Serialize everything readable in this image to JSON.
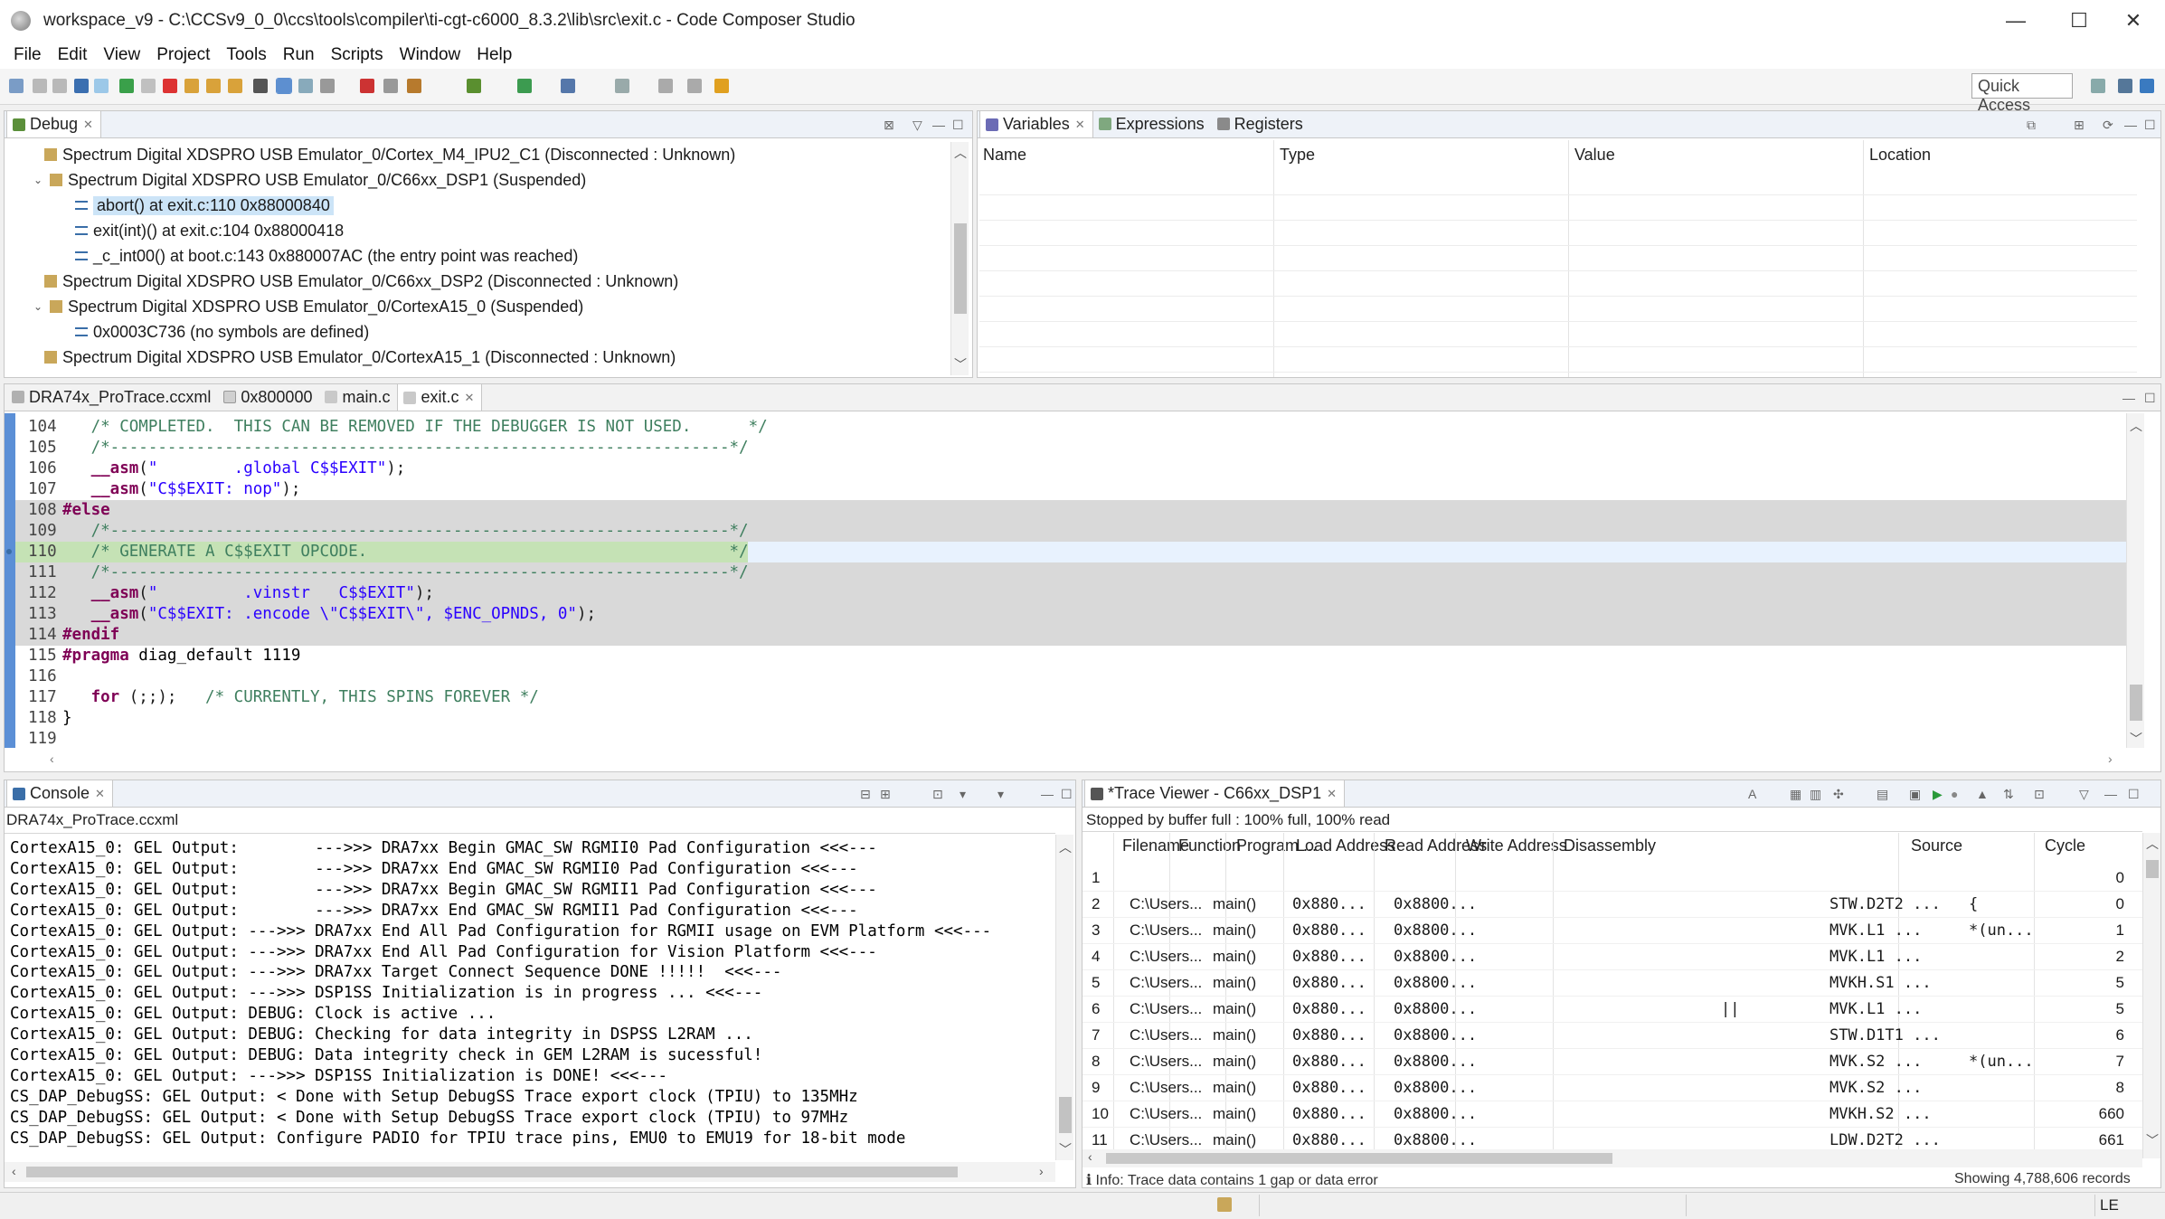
{
  "window": {
    "title": "workspace_v9 - C:\\CCSv9_0_0\\ccs\\tools\\compiler\\ti-cgt-c6000_8.3.2\\lib\\src\\exit.c - Code Composer Studio",
    "minimize": "—",
    "maximize": "☐",
    "close": "✕"
  },
  "menu": [
    "File",
    "Edit",
    "View",
    "Project",
    "Tools",
    "Run",
    "Scripts",
    "Window",
    "Help"
  ],
  "toolbar": {
    "quick_access": "Quick Access"
  },
  "debug": {
    "tab": "Debug",
    "items": [
      {
        "label": "Spectrum Digital XDSPRO USB Emulator_0/Cortex_M4_IPU2_C1 (Disconnected : Unknown)",
        "twisty": "",
        "icon": "target-icon"
      },
      {
        "label": "Spectrum Digital XDSPRO USB Emulator_0/C66xx_DSP1 (Suspended)",
        "twisty": "⌄",
        "icon": "target-icon"
      },
      {
        "label": "abort() at exit.c:110 0x88000840",
        "twisty": "",
        "icon": "stack-frame-icon"
      },
      {
        "label": "exit(int)() at exit.c:104 0x88000418",
        "twisty": "",
        "icon": "stack-frame-icon"
      },
      {
        "label": "_c_int00() at boot.c:143 0x880007AC  (the entry point was reached)",
        "twisty": "",
        "icon": "stack-frame-icon"
      },
      {
        "label": "Spectrum Digital XDSPRO USB Emulator_0/C66xx_DSP2 (Disconnected : Unknown)",
        "twisty": "",
        "icon": "target-icon"
      },
      {
        "label": "Spectrum Digital XDSPRO USB Emulator_0/CortexA15_0 (Suspended)",
        "twisty": "⌄",
        "icon": "target-icon"
      },
      {
        "label": "0x0003C736  (no symbols are defined)",
        "twisty": "",
        "icon": "stack-frame-icon"
      },
      {
        "label": "Spectrum Digital XDSPRO USB Emulator_0/CortexA15_1 (Disconnected : Unknown)",
        "twisty": "",
        "icon": "target-icon"
      }
    ]
  },
  "variables": {
    "tabs": [
      "Variables",
      "Expressions",
      "Registers"
    ],
    "columns": [
      "Name",
      "Type",
      "Value",
      "Location"
    ]
  },
  "editor": {
    "tabs": [
      "DRA74x_ProTrace.ccxml",
      "0x800000",
      "main.c",
      "exit.c"
    ],
    "lines": [
      {
        "n": "104",
        "text": "   /* COMPLETED.  THIS CAN BE REMOVED IF THE DEBUGGER IS NOT USED.      */",
        "style": "comment",
        "bg": ""
      },
      {
        "n": "105",
        "text": "   /*-----------------------------------------------------------------*/",
        "style": "comment",
        "bg": ""
      },
      {
        "n": "106",
        "text": "   __asm(\"        .global C$$EXIT\");",
        "style": "asm",
        "bg": ""
      },
      {
        "n": "107",
        "text": "   __asm(\"C$$EXIT: nop\");",
        "style": "asm",
        "bg": ""
      },
      {
        "n": "108",
        "text": "#else",
        "style": "pp",
        "bg": "gray"
      },
      {
        "n": "109",
        "text": "   /*-----------------------------------------------------------------*/",
        "style": "comment",
        "bg": "gray"
      },
      {
        "n": "110",
        "text": "   /* GENERATE A C$$EXIT OPCODE.                                      */",
        "style": "comment",
        "bg": "green"
      },
      {
        "n": "111",
        "text": "   /*-----------------------------------------------------------------*/",
        "style": "comment",
        "bg": "gray"
      },
      {
        "n": "112",
        "text": "   __asm(\"         .vinstr   C$$EXIT\");",
        "style": "asm",
        "bg": "gray"
      },
      {
        "n": "113",
        "text": "   __asm(\"C$$EXIT: .encode \\\"C$$EXIT\\\", $ENC_OPNDS, 0\");",
        "style": "asm",
        "bg": "gray"
      },
      {
        "n": "114",
        "text": "#endif",
        "style": "pp",
        "bg": "gray"
      },
      {
        "n": "115",
        "text": "#pragma diag_default 1119",
        "style": "pragma",
        "bg": ""
      },
      {
        "n": "116",
        "text": "",
        "style": "plain",
        "bg": ""
      },
      {
        "n": "117",
        "text": "   for (;;);   /* CURRENTLY, THIS SPINS FOREVER */",
        "style": "for",
        "bg": ""
      },
      {
        "n": "118",
        "text": "}",
        "style": "plain",
        "bg": ""
      },
      {
        "n": "119",
        "text": "",
        "style": "plain",
        "bg": ""
      }
    ]
  },
  "console": {
    "tab": "Console",
    "subtitle": "DRA74x_ProTrace.ccxml",
    "lines": [
      "CortexA15_0: GEL Output:        --->>> DRA7xx Begin GMAC_SW RGMII0 Pad Configuration <<<---",
      "CortexA15_0: GEL Output:        --->>> DRA7xx End GMAC_SW RGMII0 Pad Configuration <<<---",
      "CortexA15_0: GEL Output:        --->>> DRA7xx Begin GMAC_SW RGMII1 Pad Configuration <<<---",
      "CortexA15_0: GEL Output:        --->>> DRA7xx End GMAC_SW RGMII1 Pad Configuration <<<---",
      "CortexA15_0: GEL Output: --->>> DRA7xx End All Pad Configuration for RGMII usage on EVM Platform <<<---",
      "CortexA15_0: GEL Output: --->>> DRA7xx End All Pad Configuration for Vision Platform <<<---",
      "CortexA15_0: GEL Output: --->>> DRA7xx Target Connect Sequence DONE !!!!!  <<<---",
      "CortexA15_0: GEL Output: --->>> DSP1SS Initialization is in progress ... <<<---",
      "CortexA15_0: GEL Output: DEBUG: Clock is active ...",
      "CortexA15_0: GEL Output: DEBUG: Checking for data integrity in DSPSS L2RAM ...",
      "CortexA15_0: GEL Output: DEBUG: Data integrity check in GEM L2RAM is sucessful!",
      "CortexA15_0: GEL Output: --->>> DSP1SS Initialization is DONE! <<<---",
      "CS_DAP_DebugSS: GEL Output: < Done with Setup DebugSS Trace export clock (TPIU) to 135MHz",
      "CS_DAP_DebugSS: GEL Output: < Done with Setup DebugSS Trace export clock (TPIU) to 97MHz",
      "CS_DAP_DebugSS: GEL Output: Configure PADIO for TPIU trace pins, EMU0 to EMU19 for 18-bit mode"
    ]
  },
  "trace": {
    "tab": "*Trace Viewer - C66xx_DSP1",
    "status": "Stopped by buffer full : 100% full, 100% read",
    "columns": [
      "Filename",
      "Function",
      "Program ...",
      "Load Address",
      "Read Address",
      "Write Address",
      "Disassembly",
      "Source",
      "Cycle"
    ],
    "rows": [
      {
        "n": "1",
        "file": "",
        "func": "",
        "prog": "",
        "load": "",
        "dis": "",
        "mnem": "",
        "src": "",
        "cycle": "0"
      },
      {
        "n": "2",
        "file": "C:\\Users...",
        "func": "main()",
        "prog": "0x880...",
        "load": "0x8800...",
        "dis": "",
        "mnem": "STW.D2T2  ...",
        "src": "{",
        "cycle": "0"
      },
      {
        "n": "3",
        "file": "C:\\Users...",
        "func": "main()",
        "prog": "0x880...",
        "load": "0x8800...",
        "dis": "",
        "mnem": "MVK.L1    ...",
        "src": "*(un...",
        "cycle": "1"
      },
      {
        "n": "4",
        "file": "C:\\Users...",
        "func": "main()",
        "prog": "0x880...",
        "load": "0x8800...",
        "dis": "",
        "mnem": "MVK.L1    ...",
        "src": "",
        "cycle": "2"
      },
      {
        "n": "5",
        "file": "C:\\Users...",
        "func": "main()",
        "prog": "0x880...",
        "load": "0x8800...",
        "dis": "",
        "mnem": "MVKH.S1   ...",
        "src": "",
        "cycle": "5"
      },
      {
        "n": "6",
        "file": "C:\\Users...",
        "func": "main()",
        "prog": "0x880...",
        "load": "0x8800...",
        "dis": "||",
        "mnem": "MVK.L1    ...",
        "src": "",
        "cycle": "5"
      },
      {
        "n": "7",
        "file": "C:\\Users...",
        "func": "main()",
        "prog": "0x880...",
        "load": "0x8800...",
        "dis": "",
        "mnem": "STW.D1T1  ...",
        "src": "",
        "cycle": "6"
      },
      {
        "n": "8",
        "file": "C:\\Users...",
        "func": "main()",
        "prog": "0x880...",
        "load": "0x8800...",
        "dis": "",
        "mnem": "MVK.S2    ...",
        "src": "*(un...",
        "cycle": "7"
      },
      {
        "n": "9",
        "file": "C:\\Users...",
        "func": "main()",
        "prog": "0x880...",
        "load": "0x8800...",
        "dis": "",
        "mnem": "MVK.S2    ...",
        "src": "",
        "cycle": "8"
      },
      {
        "n": "10",
        "file": "C:\\Users...",
        "func": "main()",
        "prog": "0x880...",
        "load": "0x8800...",
        "dis": "",
        "mnem": "MVKH.S2   ...",
        "src": "",
        "cycle": "660"
      },
      {
        "n": "11",
        "file": "C:\\Users...",
        "func": "main()",
        "prog": "0x880...",
        "load": "0x8800...",
        "dis": "",
        "mnem": "LDW.D2T2  ...",
        "src": "",
        "cycle": "661"
      }
    ],
    "footer_info": "Info: Trace data contains 1 gap or data error",
    "footer_count": "Showing 4,788,606 records"
  },
  "statusbar": {
    "mode": "LE"
  },
  "colors": {
    "tab_strip": "#eef2f8",
    "gray_block": "#d9d9d9",
    "current_line": "#c5e2b5",
    "highlight_line": "#e8f2fe",
    "comment": "#3f7f5f",
    "keyword": "#7f0055",
    "string": "#2a00ff"
  }
}
